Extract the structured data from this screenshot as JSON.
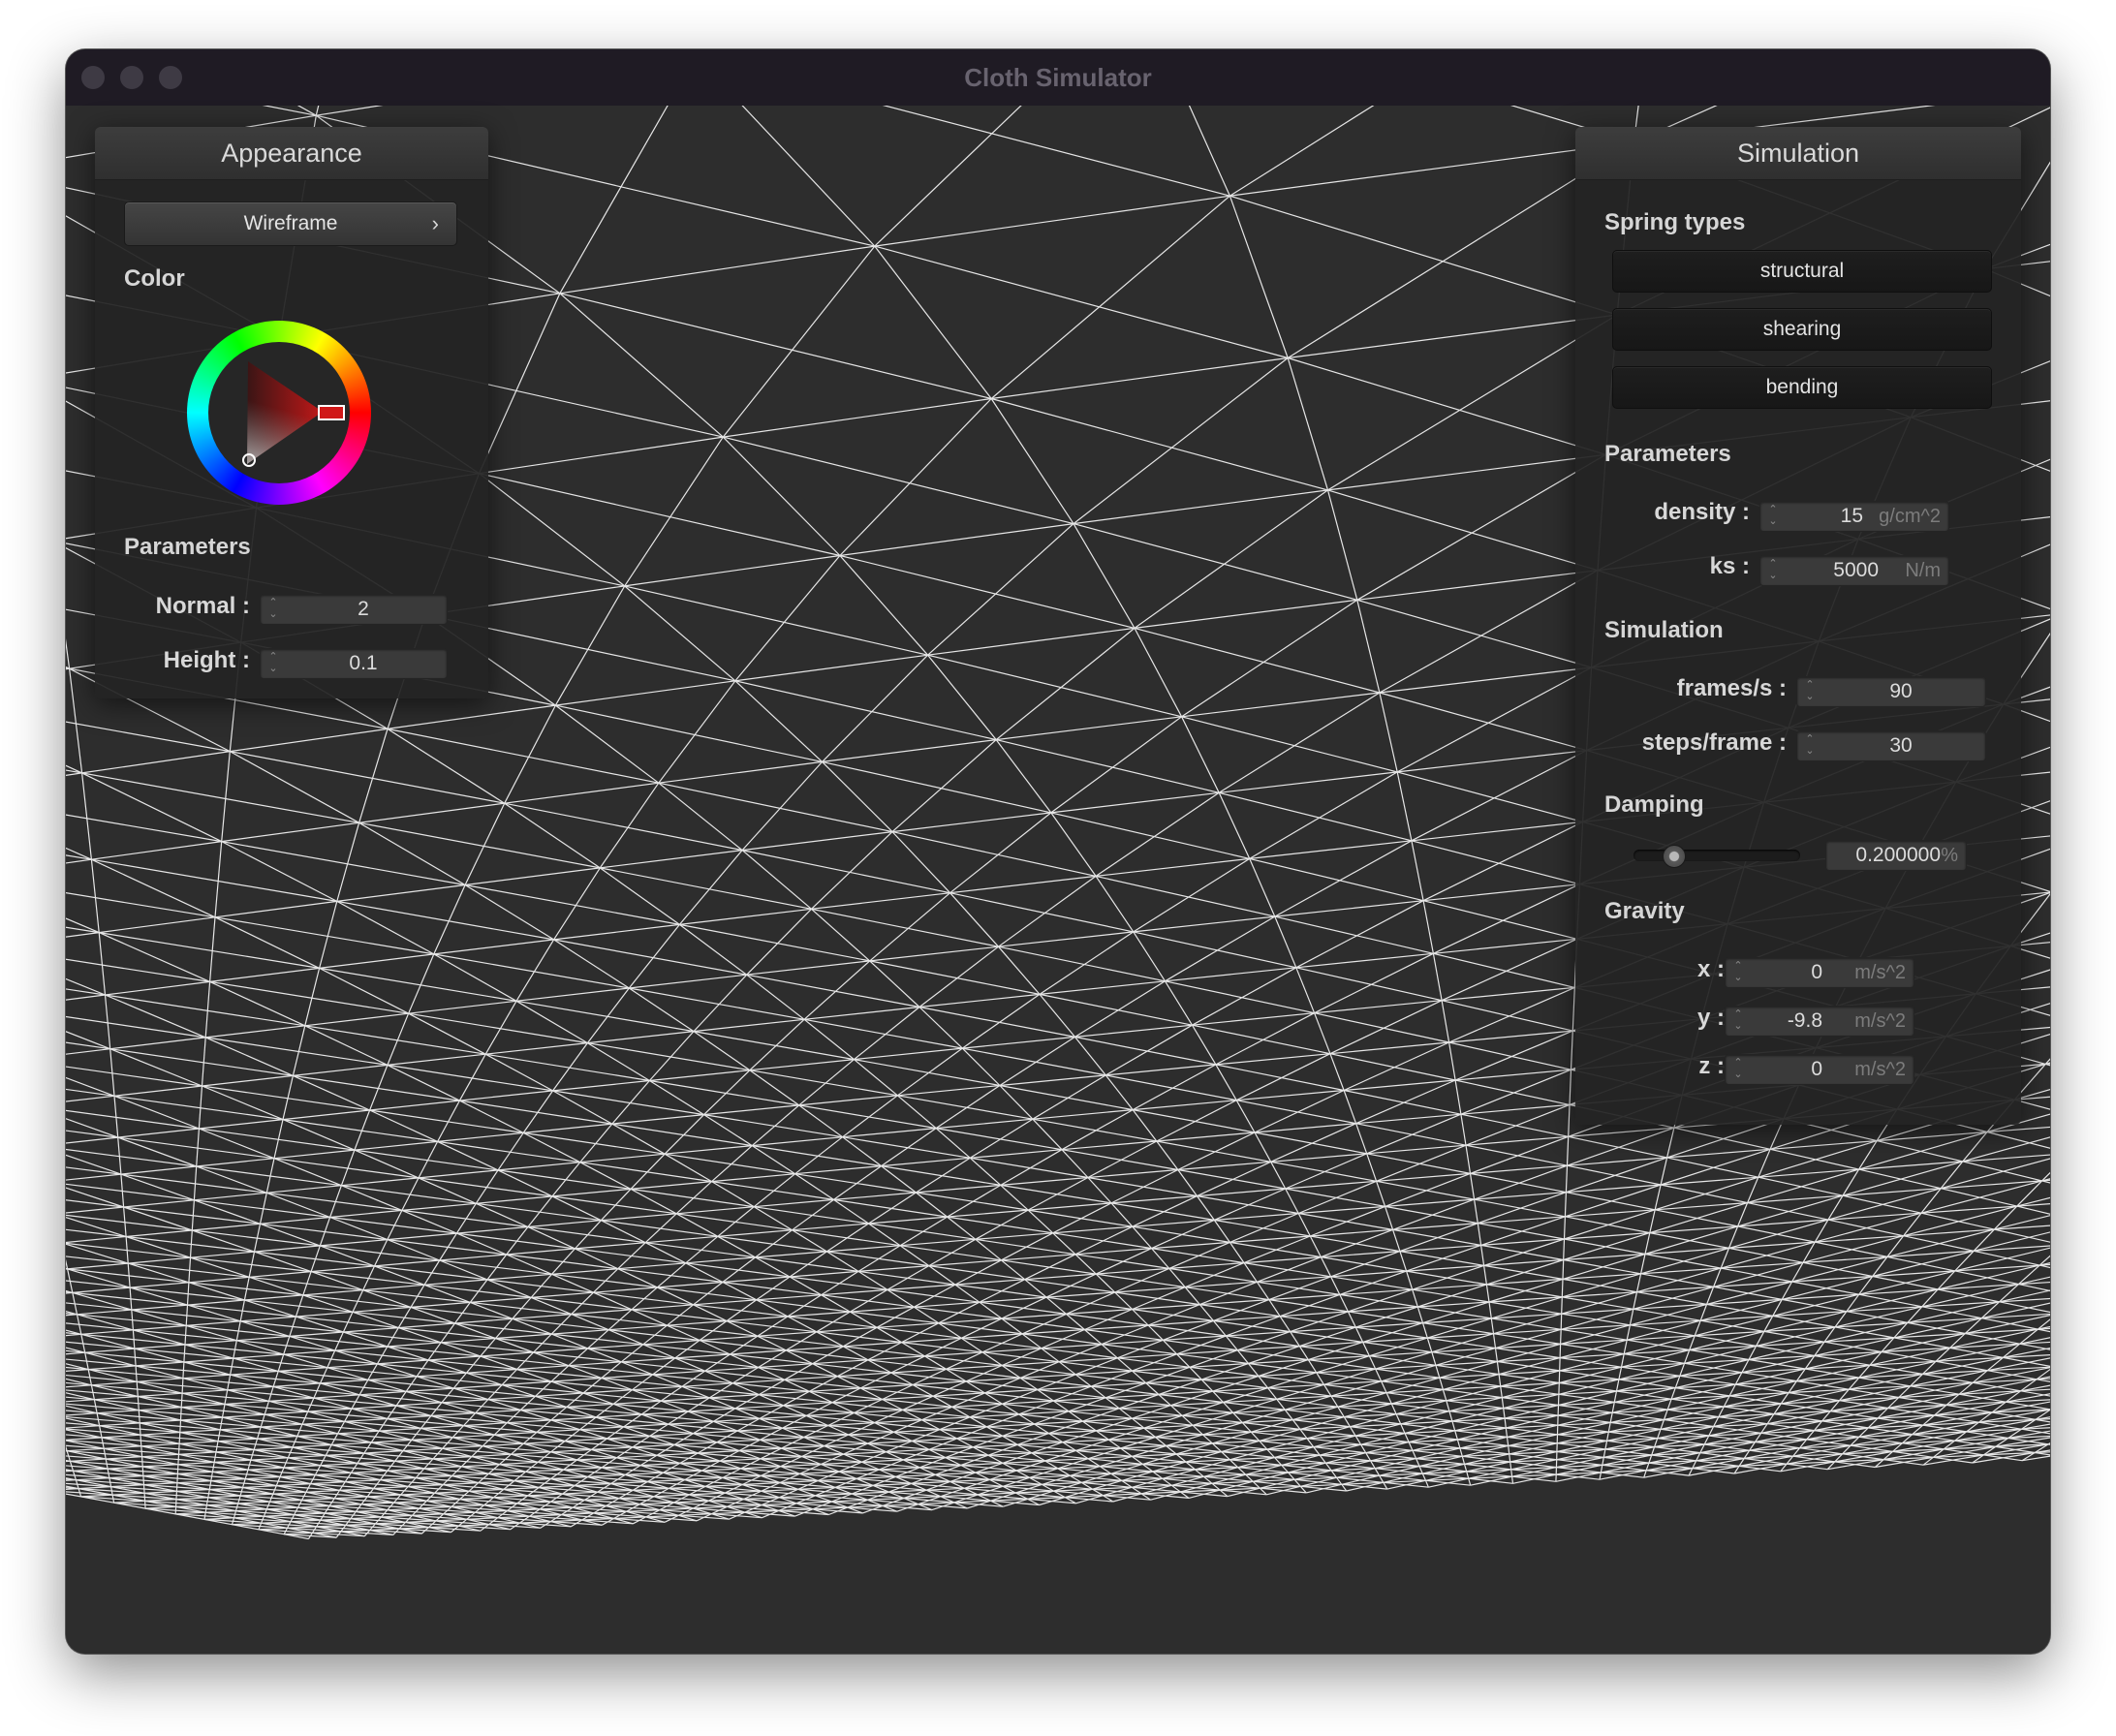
{
  "window": {
    "title": "Cloth Simulator"
  },
  "appearance": {
    "header": "Appearance",
    "shader_button": "Wireframe",
    "color_label": "Color",
    "accent_color": "#d01818",
    "parameters_label": "Parameters",
    "normal": {
      "label": "Normal :",
      "value": "2"
    },
    "height": {
      "label": "Height :",
      "value": "0.1"
    }
  },
  "simulation_panel": {
    "header": "Simulation",
    "spring_types_label": "Spring types",
    "spring_buttons": [
      "structural",
      "shearing",
      "bending"
    ],
    "parameters_label": "Parameters",
    "density": {
      "label": "density :",
      "value": "15",
      "unit": "g/cm^2"
    },
    "ks": {
      "label": "ks :",
      "value": "5000",
      "unit": "N/m"
    },
    "simulation_label": "Simulation",
    "fps": {
      "label": "frames/s :",
      "value": "90"
    },
    "steps": {
      "label": "steps/frame :",
      "value": "30"
    },
    "damping_label": "Damping",
    "damping": {
      "value": "0.200000",
      "unit": "%",
      "slider_fraction": 0.2
    },
    "gravity_label": "Gravity",
    "gravity_x": {
      "label": "x :",
      "value": "0",
      "unit": "m/s^2"
    },
    "gravity_y": {
      "label": "y :",
      "value": "-9.8",
      "unit": "m/s^2"
    },
    "gravity_z": {
      "label": "z :",
      "value": "0",
      "unit": "m/s^2"
    }
  }
}
